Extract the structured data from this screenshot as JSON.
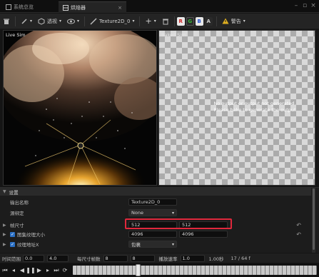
{
  "tabs": [
    {
      "label": "系统总览"
    },
    {
      "label": "烘焙器"
    }
  ],
  "toolbar": {
    "view_label": "透视",
    "texture_name": "Texture2D_0",
    "channels": [
      "R",
      "G",
      "B",
      "A"
    ],
    "warning_label": "警告"
  },
  "viewport_left": {
    "label": "Live Sim"
  },
  "viewport_right": {
    "label": "Baked Sim",
    "message_line1": "No output or output not generated.",
    "message_line2": "Please bake to generate the output"
  },
  "settings": {
    "section_label": "设置",
    "output_name_label": "输出名称",
    "output_name_value": "Texture2D_0",
    "source_binding_label": "源绑定",
    "source_binding_value": "None",
    "frame_size_label": "帧尺寸",
    "frame_size_x": "512",
    "frame_size_y": "512",
    "atlas_size_label": "图集纹理大小",
    "atlas_size_x": "4096",
    "atlas_size_y": "4096",
    "texture_address_label": "纹理地址X",
    "texture_address_value": "包裹"
  },
  "bottom": {
    "duration_label": "时间范围",
    "duration_start": "0.0",
    "duration_end": "4.0",
    "frames_per_dim_label": "每尺寸帧数",
    "frames_x": "8",
    "frames_y": "8",
    "playback_rate_label": "播放速率",
    "playback_rate": "1.0",
    "time_display": "1.00秒",
    "frame_counter": "17 / 64 f"
  }
}
